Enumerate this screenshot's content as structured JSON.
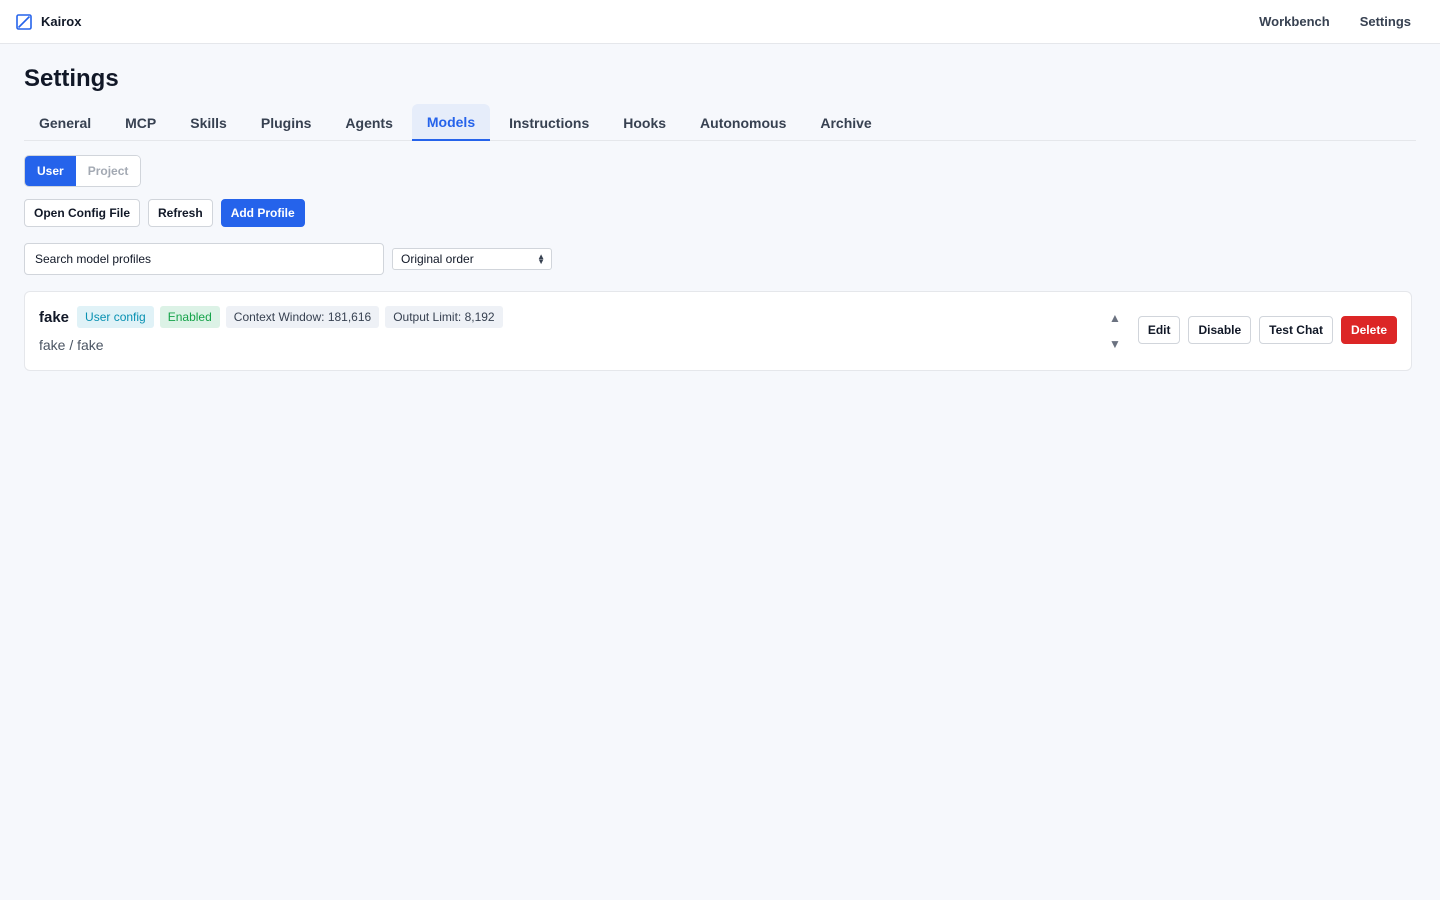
{
  "app": {
    "name": "Kairox"
  },
  "topnav": {
    "workbench": "Workbench",
    "settings": "Settings"
  },
  "page": {
    "title": "Settings"
  },
  "tabs": [
    {
      "label": "General"
    },
    {
      "label": "MCP"
    },
    {
      "label": "Skills"
    },
    {
      "label": "Plugins"
    },
    {
      "label": "Agents"
    },
    {
      "label": "Models",
      "active": true
    },
    {
      "label": "Instructions"
    },
    {
      "label": "Hooks"
    },
    {
      "label": "Autonomous"
    },
    {
      "label": "Archive"
    }
  ],
  "scope": {
    "user": "User",
    "project": "Project",
    "selected": "User"
  },
  "actions": {
    "open_config": "Open Config File",
    "refresh": "Refresh",
    "add_profile": "Add Profile"
  },
  "search": {
    "placeholder": "Search model profiles",
    "value": ""
  },
  "sort": {
    "selected": "Original order"
  },
  "profiles": [
    {
      "name": "fake",
      "source_badge": "User config",
      "status_badge": "Enabled",
      "context_window": "Context Window: 181,616",
      "output_limit": "Output Limit: 8,192",
      "provider_model": "fake / fake",
      "move_up": "▲",
      "move_down": "▼",
      "edit": "Edit",
      "disable": "Disable",
      "test_chat": "Test Chat",
      "delete": "Delete"
    }
  ],
  "colors": {
    "accent": "#2563eb",
    "danger": "#dc2626",
    "background": "#f6f8fc"
  }
}
